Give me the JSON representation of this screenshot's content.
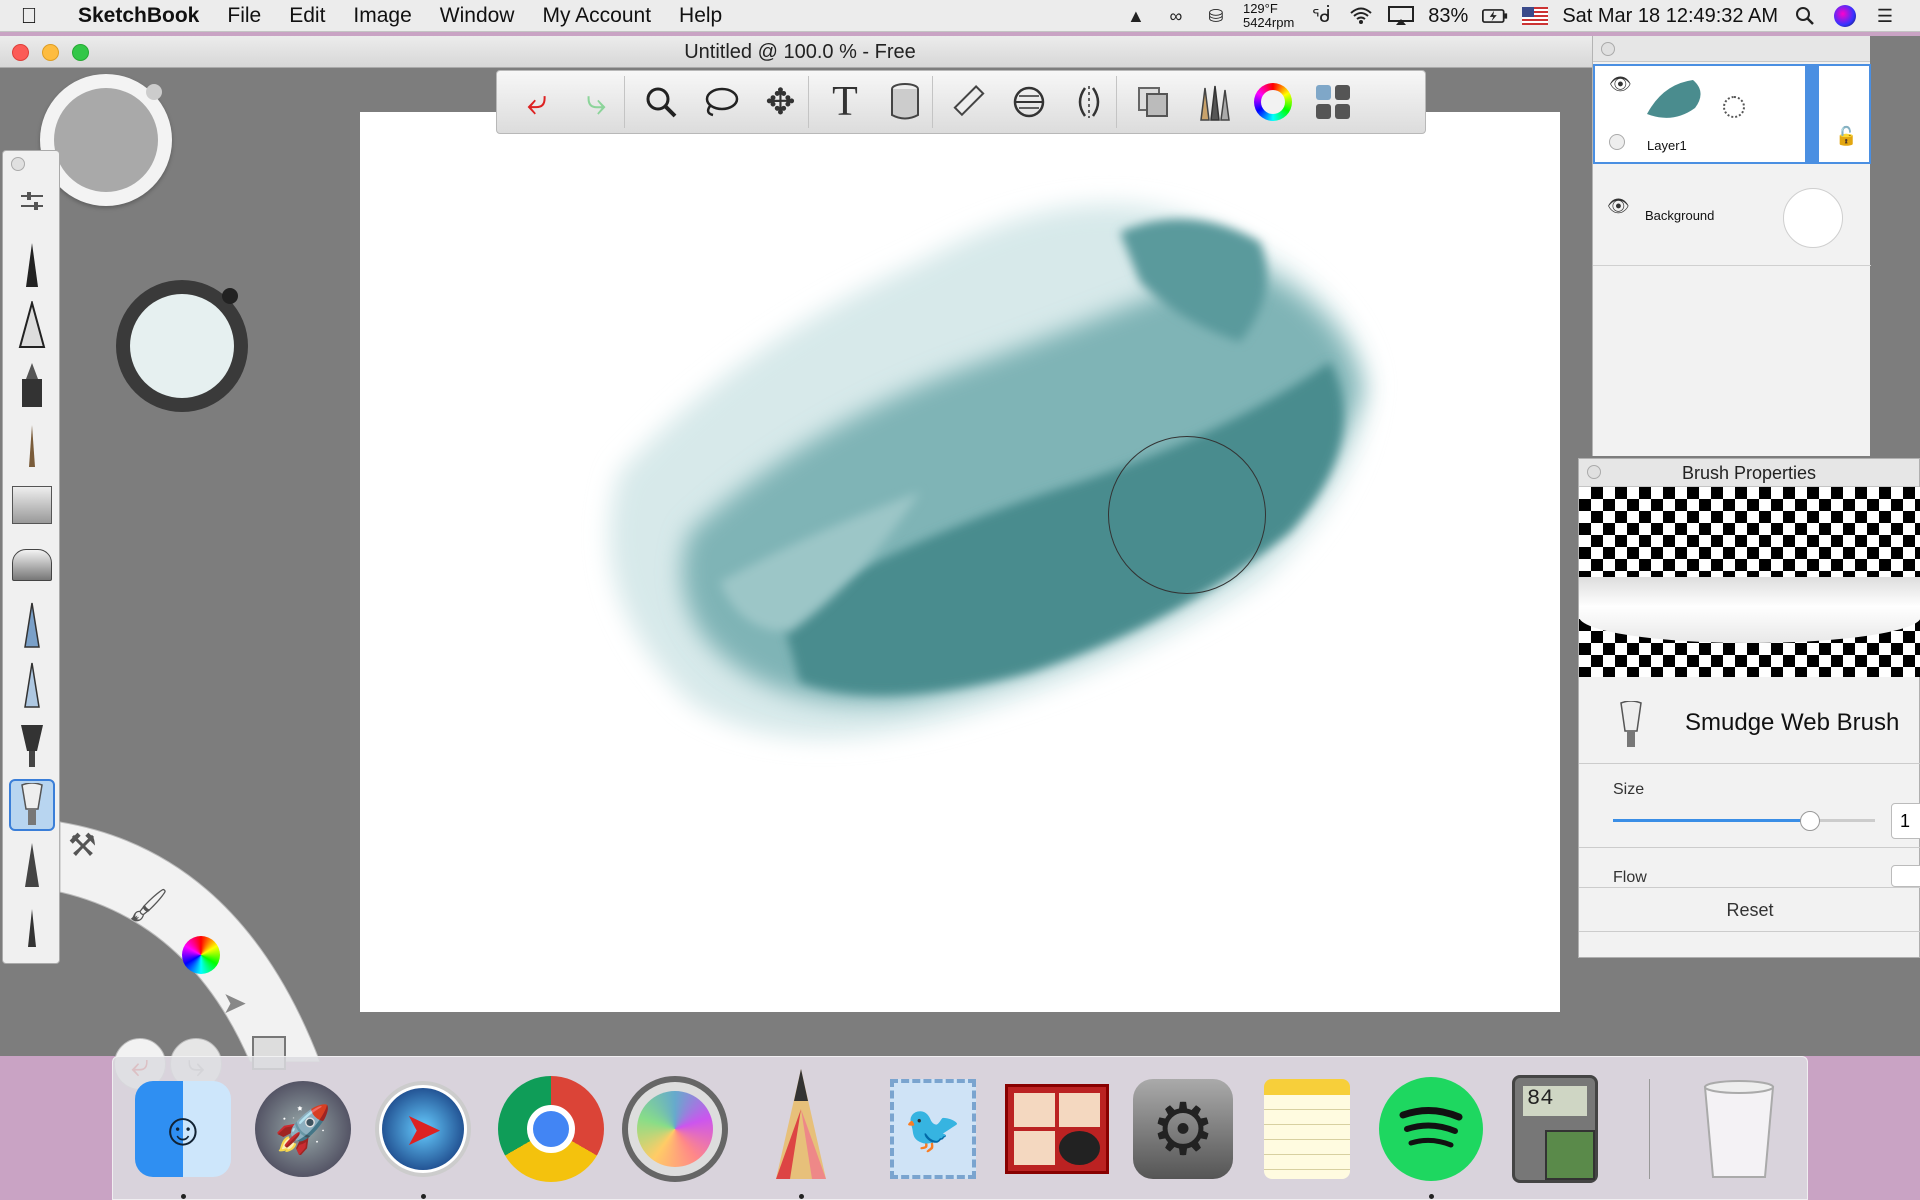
{
  "menubar": {
    "app_name": "SketchBook",
    "menus": [
      "File",
      "Edit",
      "Image",
      "Window",
      "My Account",
      "Help"
    ],
    "temp": "129°F",
    "rpm": "5424rpm",
    "battery": "83%",
    "datetime": "Sat Mar 18  12:49:32 AM"
  },
  "window": {
    "title": "Untitled @ 100.0 % - Free"
  },
  "layers": {
    "items": [
      {
        "name": "Layer1"
      },
      {
        "name": "Background"
      }
    ]
  },
  "brush_properties": {
    "title": "Brush Properties",
    "brush_name": "Smudge Web Brush",
    "size_label": "Size",
    "size_value_partial": "1",
    "size_level": 0.75,
    "flow_label": "Flow",
    "reset_label": "Reset"
  },
  "colors": {
    "paint": "#4a8c8e",
    "selection": "#3a7ed8"
  }
}
